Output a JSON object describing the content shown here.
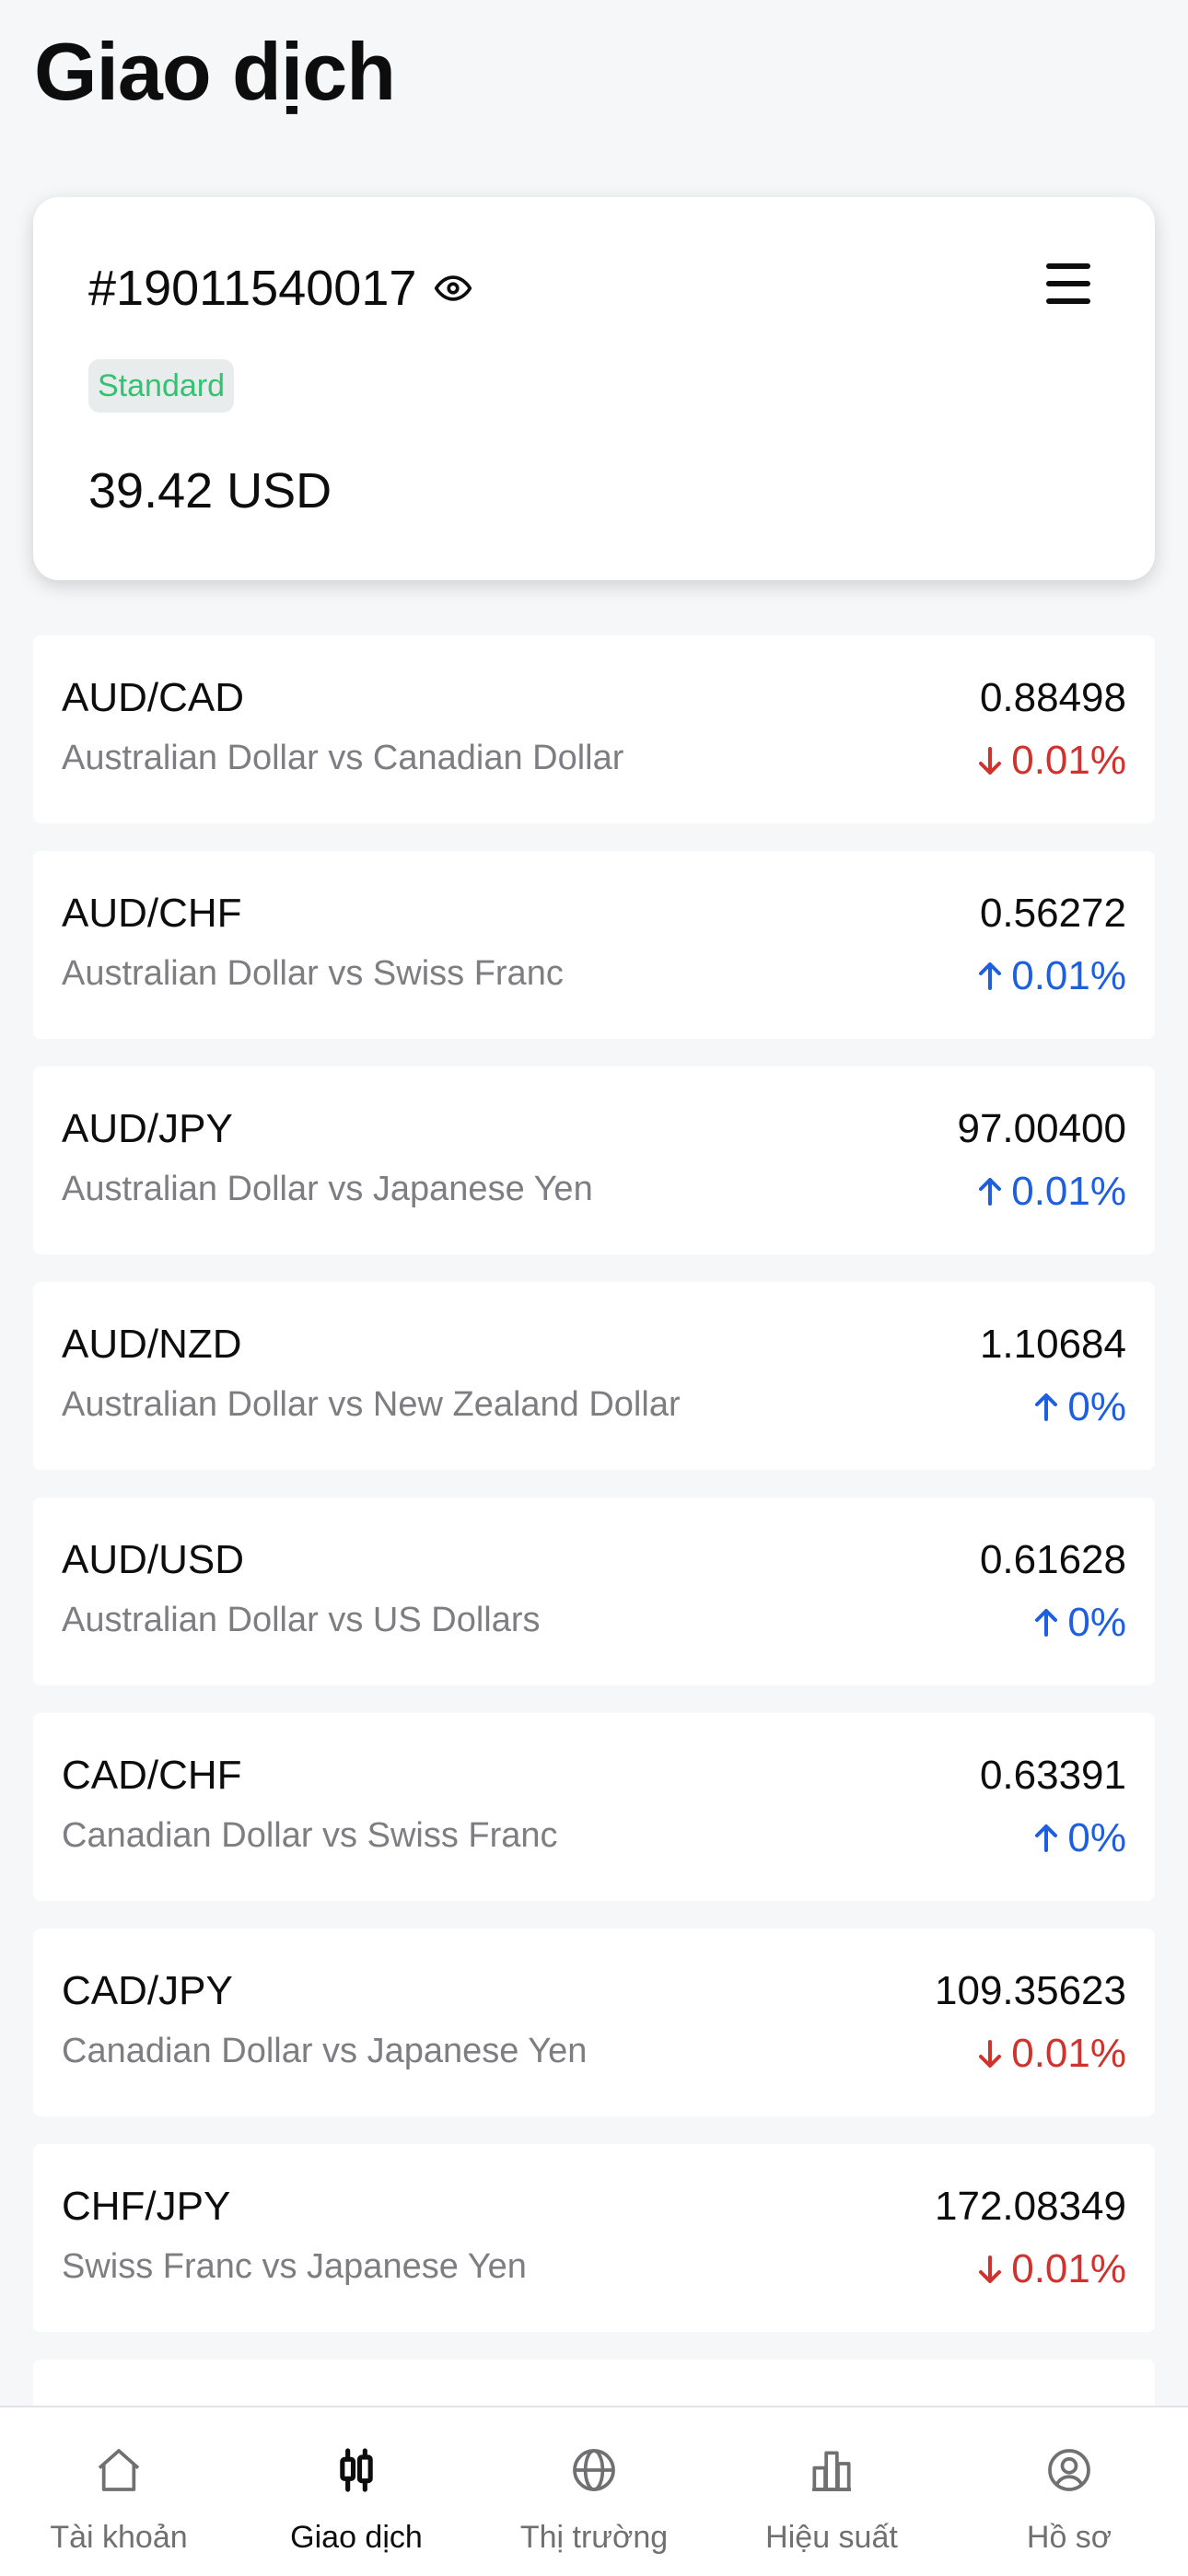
{
  "header": {
    "title": "Giao dịch"
  },
  "account": {
    "number": "#19011540017",
    "badge": "Standard",
    "balance": "39.42 USD",
    "badge_color": "#35c172"
  },
  "colors": {
    "down": "#d0322d",
    "up": "#1d5fe0"
  },
  "instruments": [
    {
      "symbol": "AUD/CAD",
      "name": "Australian Dollar vs Canadian Dollar",
      "price": "0.88498",
      "change": "0.01%",
      "direction": "down"
    },
    {
      "symbol": "AUD/CHF",
      "name": "Australian Dollar vs Swiss Franc",
      "price": "0.56272",
      "change": "0.01%",
      "direction": "up"
    },
    {
      "symbol": "AUD/JPY",
      "name": "Australian Dollar vs Japanese Yen",
      "price": "97.00400",
      "change": "0.01%",
      "direction": "up"
    },
    {
      "symbol": "AUD/NZD",
      "name": "Australian Dollar vs New Zealand Dollar",
      "price": "1.10684",
      "change": "0%",
      "direction": "up"
    },
    {
      "symbol": "AUD/USD",
      "name": "Australian Dollar vs US Dollars",
      "price": "0.61628",
      "change": "0%",
      "direction": "up"
    },
    {
      "symbol": "CAD/CHF",
      "name": "Canadian Dollar vs Swiss Franc",
      "price": "0.63391",
      "change": "0%",
      "direction": "up"
    },
    {
      "symbol": "CAD/JPY",
      "name": "Canadian Dollar vs Japanese Yen",
      "price": "109.35623",
      "change": "0.01%",
      "direction": "down"
    },
    {
      "symbol": "CHF/JPY",
      "name": "Swiss Franc vs Japanese Yen",
      "price": "172.08349",
      "change": "0.01%",
      "direction": "down"
    }
  ],
  "tabs": [
    {
      "label": "Tài khoản",
      "icon": "home-icon"
    },
    {
      "label": "Giao dịch",
      "icon": "candlestick-icon",
      "active": true
    },
    {
      "label": "Thị trường",
      "icon": "globe-icon"
    },
    {
      "label": "Hiệu suất",
      "icon": "bar-chart-icon"
    },
    {
      "label": "Hồ sơ",
      "icon": "profile-icon"
    }
  ]
}
